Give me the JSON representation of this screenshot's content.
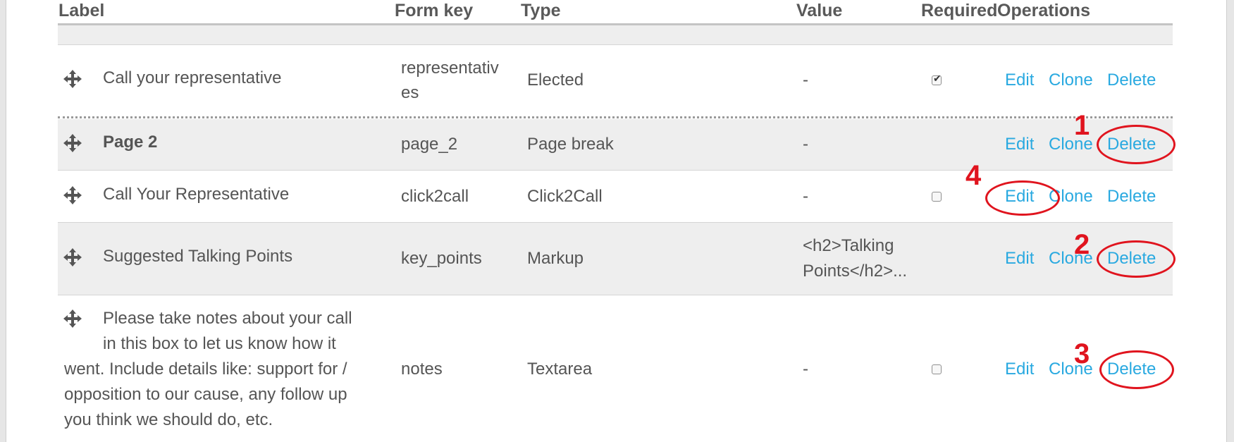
{
  "columns": {
    "label": "Label",
    "form_key": "Form key",
    "type": "Type",
    "value": "Value",
    "required": "Required",
    "operations": "Operations"
  },
  "rows": [
    {
      "label": "Call your representative",
      "form_key_lines": [
        "representativ",
        "es"
      ],
      "type": "Elected",
      "value": "-",
      "required": true,
      "ops": {
        "edit": "Edit",
        "clone": "Clone",
        "delete": "Delete"
      }
    },
    {
      "label": "Page 2",
      "form_key": "page_2",
      "type": "Page break",
      "value": "-",
      "ops": {
        "edit": "Edit",
        "clone": "Clone",
        "delete": "Delete"
      }
    },
    {
      "label": "Call Your Representative",
      "form_key": "click2call",
      "type": "Click2Call",
      "value": "-",
      "required": false,
      "ops": {
        "edit": "Edit",
        "clone": "Clone",
        "delete": "Delete"
      }
    },
    {
      "label": "Suggested Talking Points",
      "form_key": "key_points",
      "type": "Markup",
      "value_lines": [
        "<h2>Talking",
        "Points</h2>..."
      ],
      "ops": {
        "edit": "Edit",
        "clone": "Clone",
        "delete": "Delete"
      }
    },
    {
      "label_lines": [
        "Please take notes about your call",
        "in this box to let us know how it",
        "went. Include details like: support for /",
        "opposition to our cause, any follow up",
        "you think we should do, etc."
      ],
      "form_key": "notes",
      "type": "Textarea",
      "value": "-",
      "required": false,
      "ops": {
        "edit": "Edit",
        "clone": "Clone",
        "delete": "Delete"
      }
    }
  ],
  "annotations": {
    "n1": "1",
    "n2": "2",
    "n3": "3",
    "n4": "4",
    "color": "#e0141e"
  },
  "colors": {
    "link": "#29a9e0",
    "text": "#555555",
    "row_shade": "#eeeeee"
  },
  "icons": {
    "drag_handle": "move-arrows-icon"
  }
}
